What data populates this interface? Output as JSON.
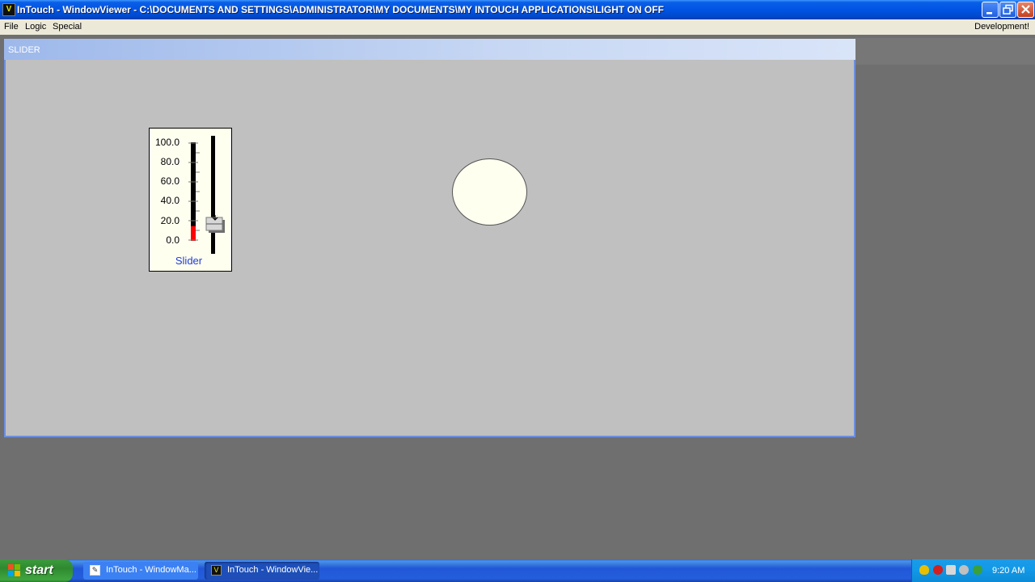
{
  "app": {
    "title": "InTouch - WindowViewer - C:\\DOCUMENTS AND SETTINGS\\ADMINISTRATOR\\MY DOCUMENTS\\MY INTOUCH APPLICATIONS\\LIGHT ON OFF"
  },
  "menu": {
    "items": [
      "File",
      "Logic",
      "Special"
    ],
    "right": "Development!"
  },
  "window": {
    "title": "SLIDER"
  },
  "slider": {
    "scale_labels": [
      "100.0",
      "80.0",
      "60.0",
      "40.0",
      "20.0",
      "0.0"
    ],
    "caption": "Slider",
    "value_percent": 15,
    "fill_color": "#ff0000",
    "caption_color": "#1e3bd6"
  },
  "lamp": {
    "state": "off",
    "color": "#fffff0"
  },
  "taskbar": {
    "start_label": "start",
    "tasks": [
      "InTouch - WindowMa...",
      "InTouch - WindowVie..."
    ],
    "clock": "9:20 AM"
  },
  "colors": {
    "titlebar": "#0054e3",
    "menubar": "#ece9d8",
    "workspace": "#6f6f6f",
    "window_body": "#c0c0c0"
  }
}
